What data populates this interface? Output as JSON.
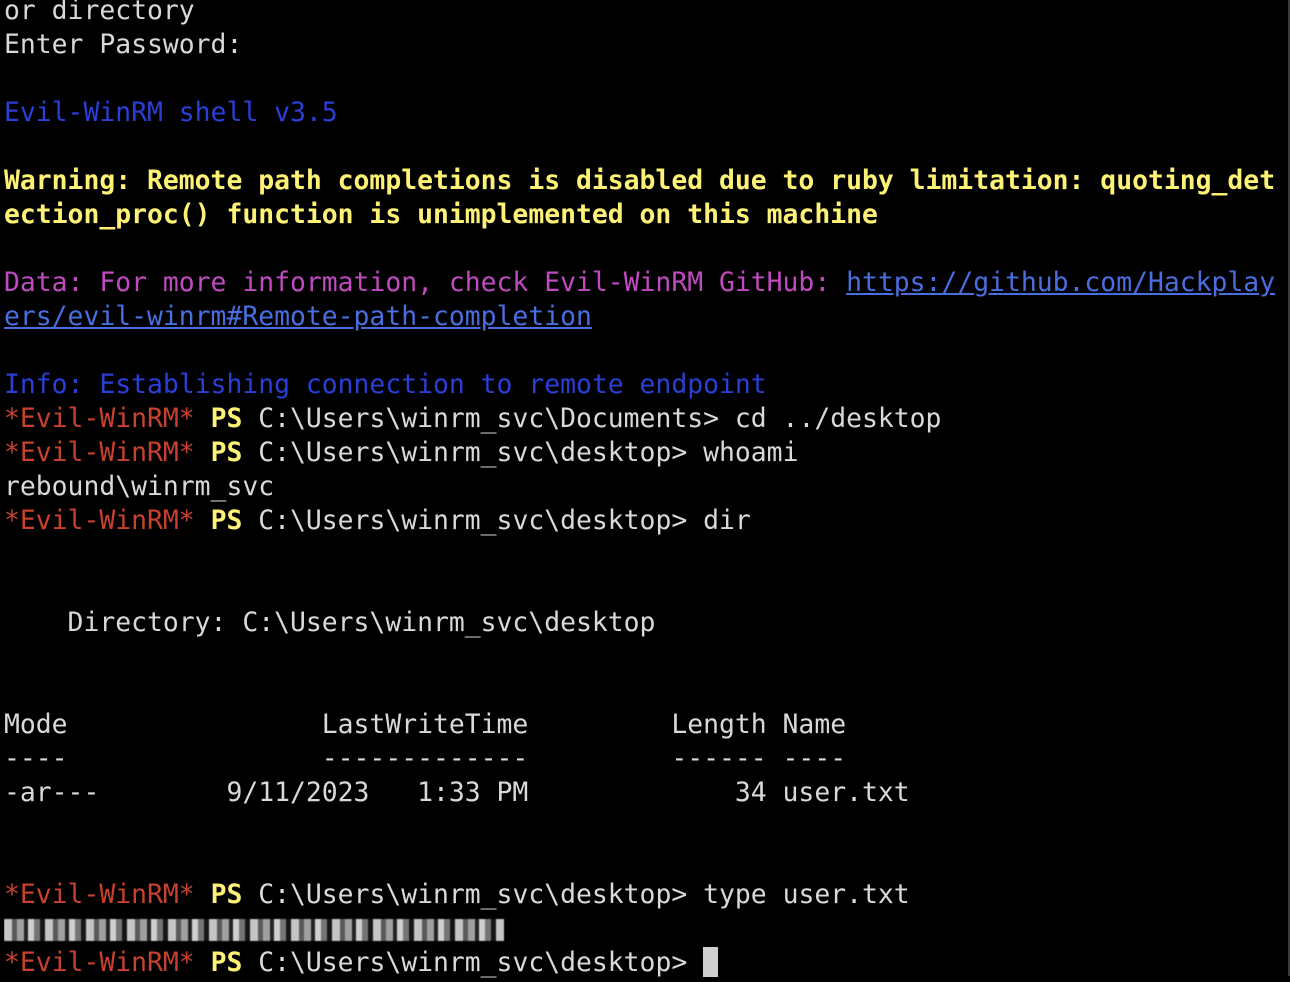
{
  "lines": {
    "l1": "or directory",
    "l2": "Enter Password:",
    "l4": "Evil-WinRM shell v3.5",
    "l6": "Warning: Remote path completions is disabled due to ruby limitation: quoting_det",
    "l7": "ection_proc() function is unimplemented on this machine",
    "l9_prefix": "Data: For more information, check Evil-WinRM GitHub: ",
    "l9_link": "https://github.com/Hackplay",
    "l10_link": "ers/evil-winrm#Remote-path-completion",
    "l12": "Info: Establishing connection to remote endpoint",
    "whoami_output": "rebound\\winrm_svc",
    "directory_header": "    Directory: C:\\Users\\winrm_svc\\desktop",
    "table_header": "Mode                LastWriteTime         Length Name",
    "table_rule": "----                -------------         ------ ----",
    "table_row": "-ar---        9/11/2023   1:33 PM             34 user.txt"
  },
  "prompt": {
    "name": "*Evil-WinRM*",
    "ps": "PS"
  },
  "commands": [
    {
      "path": " C:\\Users\\winrm_svc\\Documents> ",
      "cmd": "cd ../desktop"
    },
    {
      "path": " C:\\Users\\winrm_svc\\desktop> ",
      "cmd": "whoami"
    },
    {
      "path": " C:\\Users\\winrm_svc\\desktop> ",
      "cmd": "dir"
    },
    {
      "path": " C:\\Users\\winrm_svc\\desktop> ",
      "cmd": "type user.txt"
    },
    {
      "path": " C:\\Users\\winrm_svc\\desktop> ",
      "cmd": ""
    }
  ],
  "colors": {
    "background": "#000000",
    "info_blue": "#2a3fd6",
    "warning_yellow": "#fdf275",
    "data_magenta": "#c04bc0",
    "prompt_red": "#c8412e"
  }
}
